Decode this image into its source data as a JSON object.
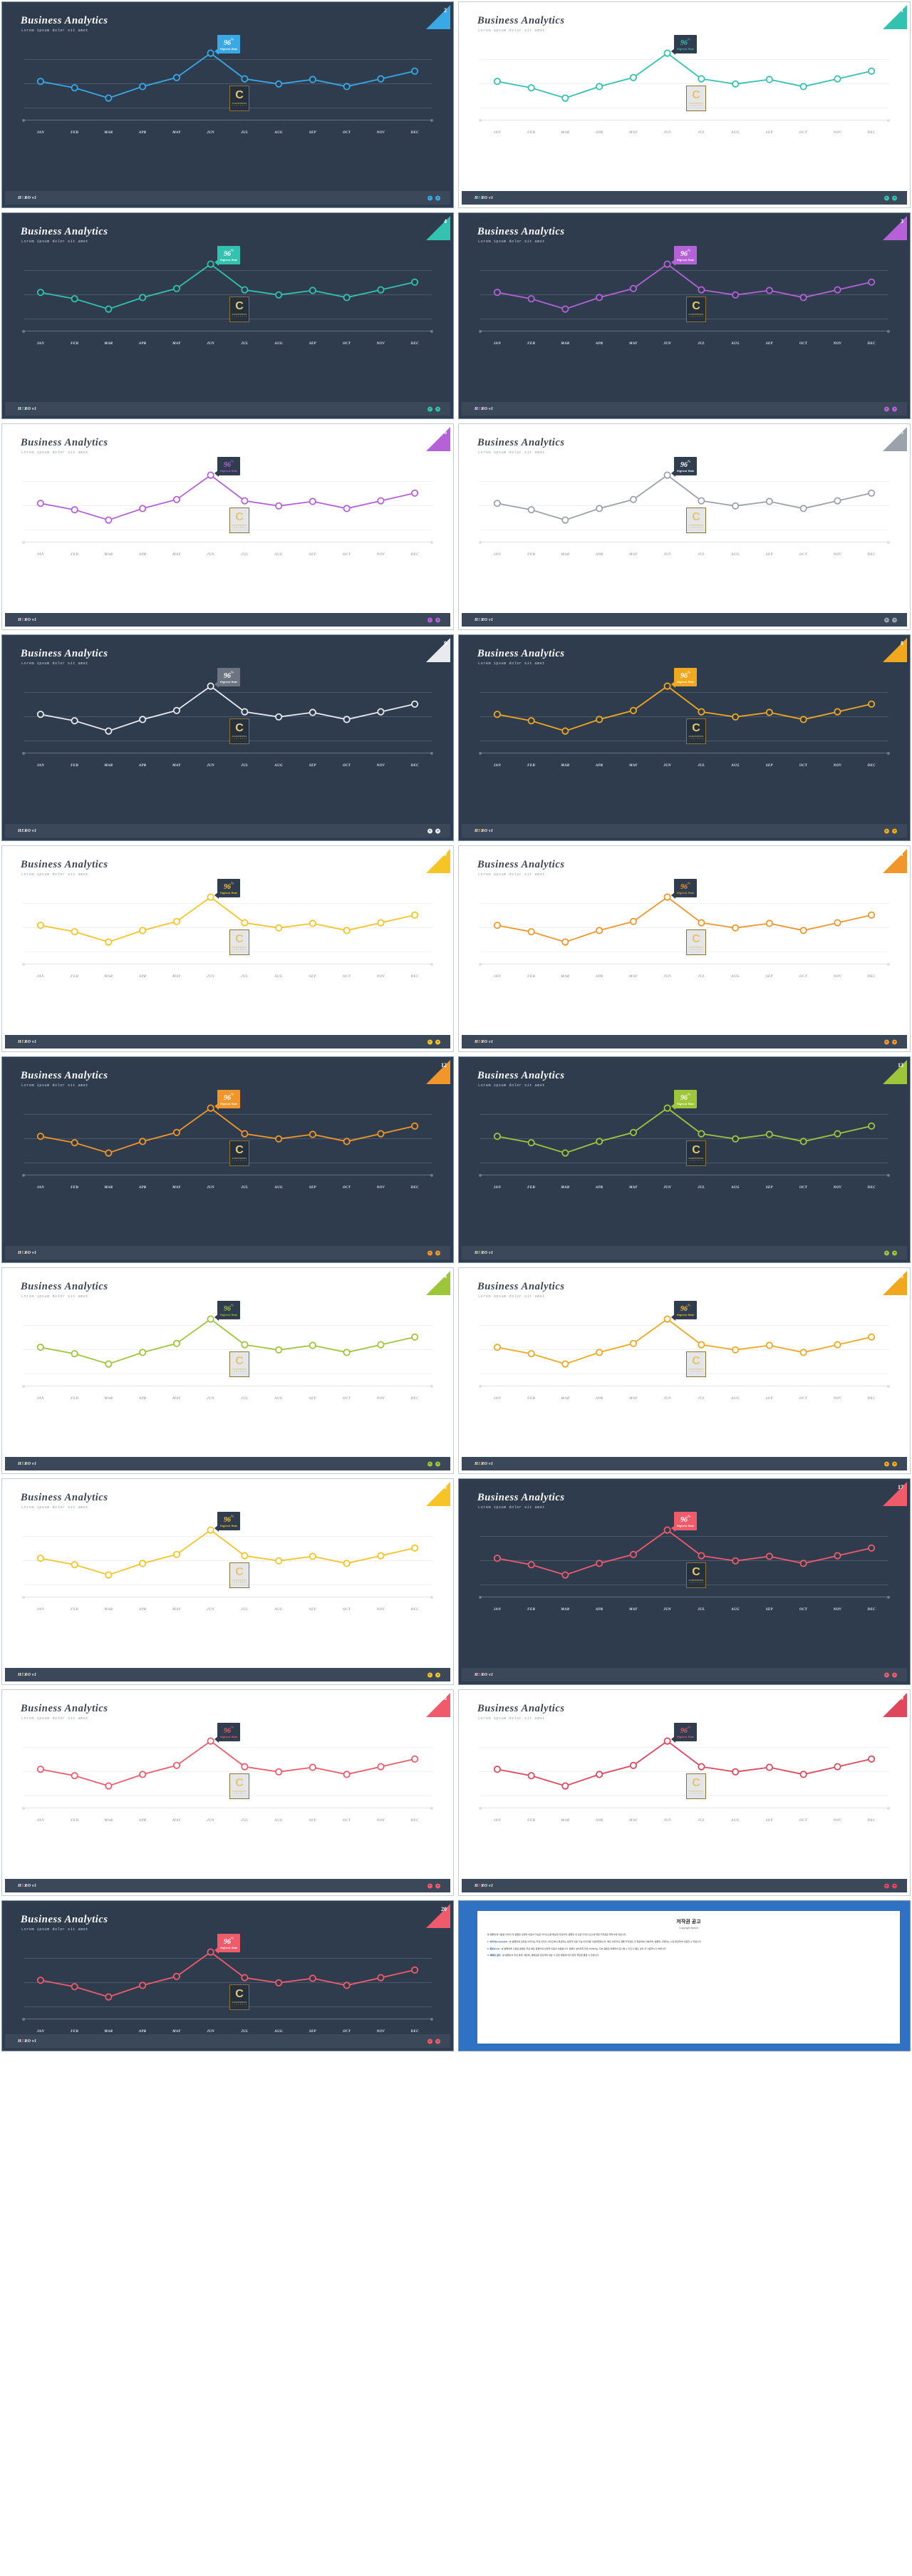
{
  "page": {
    "background": "#ffffff",
    "columns": 2,
    "slide_count": 21
  },
  "common": {
    "title": "Business Analytics",
    "subtitle": "Lorem ipsum dolor sit amet",
    "footer_label": "HERO v1",
    "footer_label_parts": [
      "H",
      "E",
      "RO v1"
    ],
    "nav_prev_icon": "chevron-left-icon",
    "nav_next_icon": "chevron-right-icon",
    "tooltip": {
      "value": "96",
      "unit": "%",
      "label": "Highest Rate"
    },
    "watermark": {
      "letter": "C",
      "line1": "CONTENTS",
      "line2": "C O N T E N T S"
    },
    "months": [
      "JAN",
      "FEB",
      "MAR",
      "APR",
      "MAY",
      "JUN",
      "JUL",
      "AUG",
      "SEP",
      "OCT",
      "NOV",
      "DEC"
    ]
  },
  "chart_data": {
    "type": "line",
    "title": "Business Analytics",
    "subtitle": "Lorem ipsum dolor sit amet",
    "xlabel": "",
    "ylabel": "",
    "ylim": [
      0,
      100
    ],
    "grid": true,
    "legend": false,
    "categories": [
      "JAN",
      "FEB",
      "MAR",
      "APR",
      "MAY",
      "JUN",
      "JUL",
      "AUG",
      "SEP",
      "OCT",
      "NOV",
      "DEC"
    ],
    "annotations": [
      {
        "category": "JUN",
        "text": "96%",
        "sublabel": "Highest Rate"
      }
    ],
    "series": [
      {
        "name": "Business Analytics",
        "values": [
          52,
          42,
          26,
          44,
          58,
          96,
          56,
          48,
          55,
          44,
          56,
          68
        ]
      }
    ]
  },
  "slides": [
    {
      "n": "2",
      "theme": "dark",
      "accent": "#38a9e4",
      "tip_bg": "#38a9e4",
      "tip_fg": "#ffffff"
    },
    {
      "n": "1",
      "theme": "light",
      "accent": "#33c2b0",
      "tip_bg": "#303d4f",
      "tip_fg": "#33c2b0"
    },
    {
      "n": "4",
      "theme": "dark",
      "accent": "#33c2b0",
      "tip_bg": "#33c2b0",
      "tip_fg": "#ffffff"
    },
    {
      "n": "3",
      "theme": "dark",
      "accent": "#b561d8",
      "tip_bg": "#b561d8",
      "tip_fg": "#ffffff"
    },
    {
      "n": "6",
      "theme": "light",
      "accent": "#b561d8",
      "tip_bg": "#303d4f",
      "tip_fg": "#b561d8"
    },
    {
      "n": "5",
      "theme": "light",
      "accent": "#9ba2ac",
      "tip_bg": "#303d4f",
      "tip_fg": "#ffffff"
    },
    {
      "n": "9",
      "theme": "dark",
      "accent": "#e8eaee",
      "tip_bg": "#6b7480",
      "tip_fg": "#ffffff"
    },
    {
      "n": "8",
      "theme": "dark",
      "accent": "#f0a91e",
      "tip_bg": "#f0a91e",
      "tip_fg": "#ffffff"
    },
    {
      "n": "10",
      "theme": "light",
      "accent": "#f5c426",
      "tip_bg": "#303d4f",
      "tip_fg": "#f5c426"
    },
    {
      "n": "11",
      "theme": "light",
      "accent": "#f0962a",
      "tip_bg": "#303d4f",
      "tip_fg": "#f0962a"
    },
    {
      "n": "12",
      "theme": "dark",
      "accent": "#f0962a",
      "tip_bg": "#f0962a",
      "tip_fg": "#ffffff"
    },
    {
      "n": "13",
      "theme": "dark",
      "accent": "#9ec63b",
      "tip_bg": "#9ec63b",
      "tip_fg": "#ffffff"
    },
    {
      "n": "14",
      "theme": "light",
      "accent": "#9ec63b",
      "tip_bg": "#303d4f",
      "tip_fg": "#9ec63b"
    },
    {
      "n": "15",
      "theme": "light",
      "accent": "#f0a91e",
      "tip_bg": "#303d4f",
      "tip_fg": "#f5c426"
    },
    {
      "n": "16",
      "theme": "light",
      "accent": "#f5c426",
      "tip_bg": "#303d4f",
      "tip_fg": "#f5c426"
    },
    {
      "n": "17",
      "theme": "dark",
      "accent": "#ef5b6b",
      "tip_bg": "#ef5b6b",
      "tip_fg": "#ffffff"
    },
    {
      "n": "18",
      "theme": "light",
      "accent": "#ef5b6b",
      "tip_bg": "#303d4f",
      "tip_fg": "#ef5b6b"
    },
    {
      "n": "19",
      "theme": "light",
      "accent": "#e0465c",
      "tip_bg": "#303d4f",
      "tip_fg": "#ef5b6b"
    },
    {
      "n": "20",
      "theme": "dark",
      "accent": "#ef5b6b",
      "tip_bg": "#ef5b6b",
      "tip_fg": "#ffffff"
    }
  ],
  "document_slide": {
    "heading": "저작권 공고",
    "subheading": "Copyright Notice",
    "paragraphs": [
      "본 템플릿에 사용된 이미지 및 글꼴은 상업적 이용이 가능한 라이선스를 확보한 자료이며, 템플릿 내 모든 디자인 요소에 대한 저작권은 제작사에 있습니다.",
      "1. 이미지(copyright) : 본 템플릿에 삽입된 이미지는 무료 이미지 사이트에서 제공하는 상업적 이용 가능 이미지를 사용하였습니다. 해당 이미지의 개별 저작권은 각 제공처에 귀속되며, 템플릿 구매자는 수정·편집하여 사용할 수 있습니다.",
      "2. 폰트(font) : 본 템플릿에 사용된 글꼴은 무료 배포 글꼴이며 상업적 이용이 허용됩니다. 글꼴이 설치되지 않은 PC에서는 기본 글꼴로 대체되어 표시될 수 있으니 별도 설치 후 사용하시기 바랍니다.",
      "3. 재배포 금지 : 본 템플릿의 무단 복제, 재판매, 재배포를 금지하며 위반 시 관련 법령에 따라 법적 책임을 물을 수 있습니다."
    ]
  }
}
